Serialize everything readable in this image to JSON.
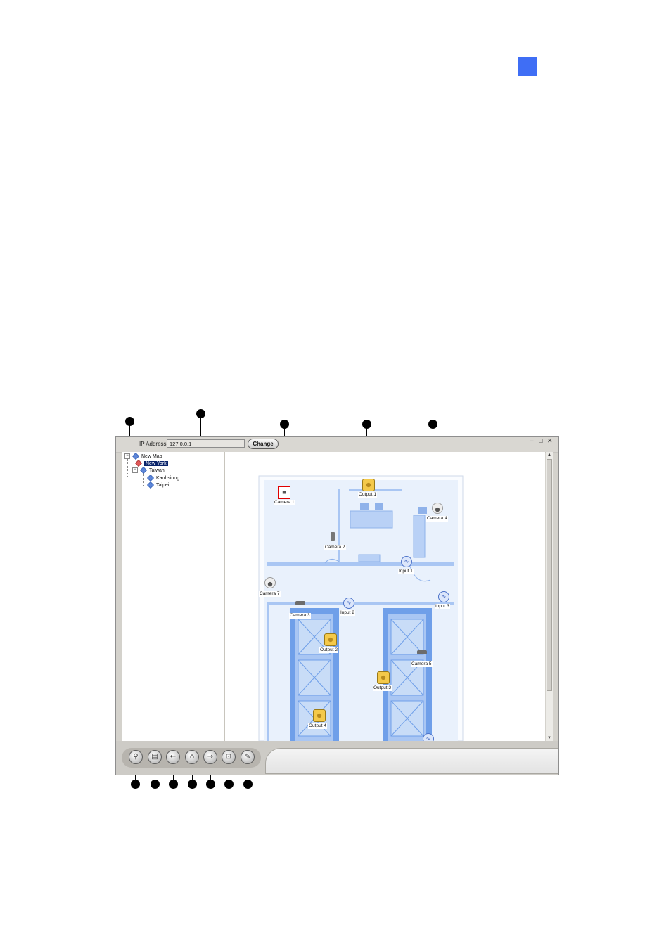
{
  "window": {
    "ip_label": "IP Address",
    "ip_value": "127.0.0.1",
    "change_label": "Change",
    "controls": [
      "–",
      "□",
      "✕"
    ]
  },
  "tree": {
    "root": "New Map",
    "items": [
      "New York",
      "Taiwan",
      "Kaohsiung",
      "Taipei"
    ]
  },
  "map": {
    "cameras": [
      "Camera 1",
      "Camera 2",
      "Camera 3",
      "Camera 4",
      "Camera 5",
      "Camera 7"
    ],
    "outputs": [
      "Output 1",
      "Output 2",
      "Output 3",
      "Output 4"
    ],
    "inputs": [
      "Input 1",
      "Input 2",
      "Input 3"
    ]
  },
  "toolbar": {
    "buttons": [
      "search-icon",
      "print-icon",
      "back-icon",
      "home-icon",
      "forward-icon",
      "zoom-icon",
      "settings-icon"
    ]
  },
  "colors": {
    "page_badge": "#3f6ef5",
    "map_floor": "#e9f1fc",
    "map_wall": "#a9c6f3",
    "map_room": "#6f9fe9"
  }
}
